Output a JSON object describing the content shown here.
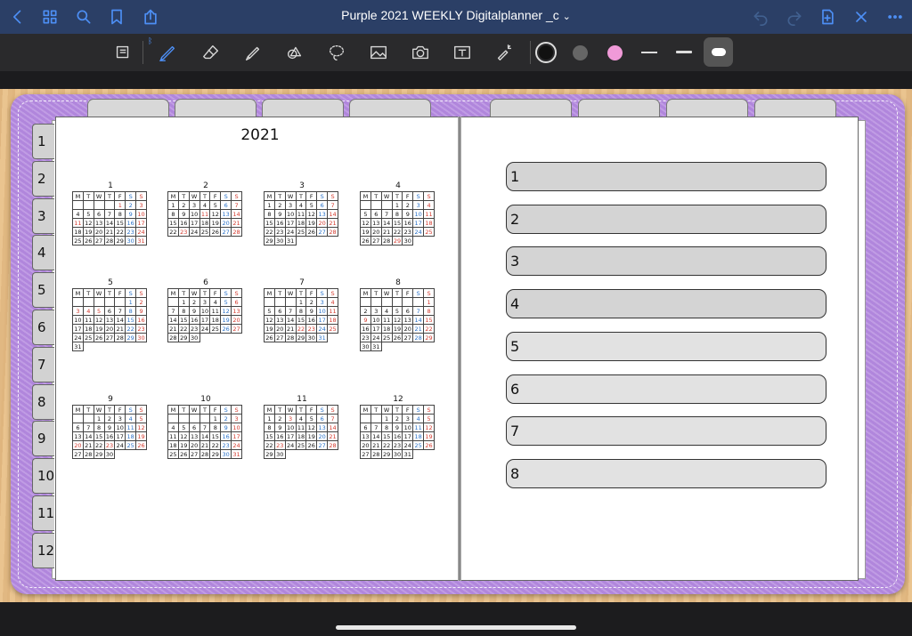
{
  "app": {
    "title": "Purple 2021 WEEKLY Digitalplanner _c",
    "title_chevron": "⌄",
    "accent": "#4d8ff5",
    "topbar_bg": "#2b3f66",
    "nav_icons_left": [
      "back-icon",
      "grid-icon",
      "search-icon",
      "bookmark-icon",
      "share-icon"
    ],
    "nav_icons_right": [
      "undo-icon",
      "redo-icon",
      "add-page-icon",
      "close-icon",
      "more-icon"
    ]
  },
  "toolbar": {
    "tools": [
      "page-setting-icon",
      "pen-icon",
      "eraser-icon",
      "highlighter-icon",
      "shapes-icon",
      "lasso-icon",
      "image-icon",
      "camera-icon",
      "text-icon",
      "laser-pointer-icon"
    ],
    "bluetooth": "ᛒ",
    "colors": [
      "#111111",
      "#666666",
      "#f09ad8"
    ],
    "sizes": [
      "thin",
      "medium",
      "thick"
    ]
  },
  "planner": {
    "year": "2021",
    "side_tabs": [
      "1",
      "2",
      "3",
      "4",
      "5",
      "6",
      "7",
      "8",
      "9",
      "10",
      "11",
      "12"
    ],
    "weekday_headers": [
      "M",
      "T",
      "W",
      "T",
      "F",
      "S",
      "S"
    ],
    "months": [
      {
        "name": "1",
        "offset": 4,
        "days": 31,
        "holidays": [
          1,
          11
        ]
      },
      {
        "name": "2",
        "offset": 0,
        "days": 28,
        "holidays": [
          11,
          23
        ]
      },
      {
        "name": "3",
        "offset": 0,
        "days": 31,
        "holidays": [
          20
        ]
      },
      {
        "name": "4",
        "offset": 3,
        "days": 30,
        "holidays": [
          29
        ]
      },
      {
        "name": "5",
        "offset": 5,
        "days": 31,
        "holidays": [
          3,
          4,
          5
        ]
      },
      {
        "name": "6",
        "offset": 1,
        "days": 30,
        "holidays": []
      },
      {
        "name": "7",
        "offset": 3,
        "days": 31,
        "holidays": [
          22,
          23
        ]
      },
      {
        "name": "8",
        "offset": 6,
        "days": 31,
        "holidays": [
          8,
          9
        ]
      },
      {
        "name": "9",
        "offset": 2,
        "days": 30,
        "holidays": [
          20,
          23
        ]
      },
      {
        "name": "10",
        "offset": 4,
        "days": 31,
        "holidays": []
      },
      {
        "name": "11",
        "offset": 0,
        "days": 30,
        "holidays": [
          3,
          23
        ]
      },
      {
        "name": "12",
        "offset": 2,
        "days": 31,
        "holidays": []
      }
    ],
    "note_bars": [
      "1",
      "2",
      "3",
      "4",
      "5",
      "6",
      "7",
      "8"
    ]
  }
}
